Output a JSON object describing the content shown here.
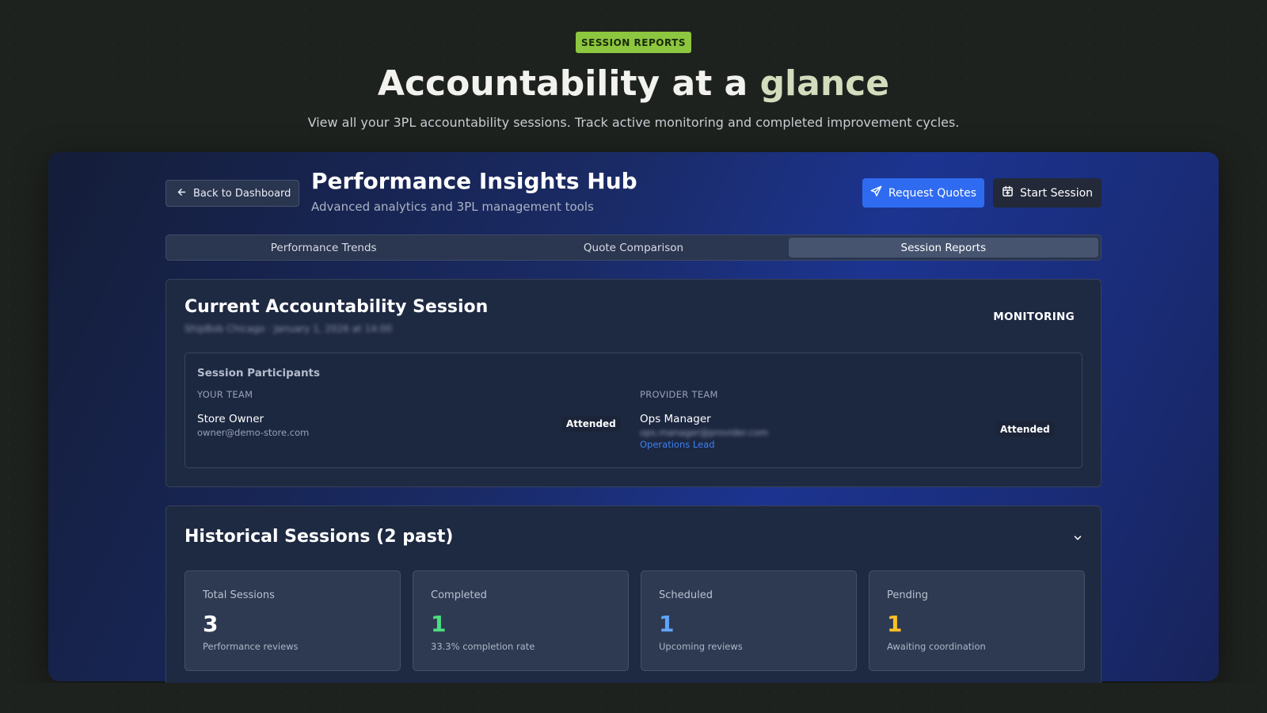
{
  "hero": {
    "badge": "SESSION REPORTS",
    "title_main": "Accountability at a ",
    "title_accent": "glance",
    "subtitle": "View all your 3PL accountability sessions. Track active monitoring and completed improvement cycles."
  },
  "header": {
    "back_label": "Back to Dashboard",
    "title": "Performance Insights Hub",
    "subtitle": "Advanced analytics and 3PL management tools",
    "request_quotes_label": "Request Quotes",
    "start_session_label": "Start Session"
  },
  "tabs": [
    {
      "label": "Performance Trends",
      "active": false
    },
    {
      "label": "Quote Comparison",
      "active": false
    },
    {
      "label": "Session Reports",
      "active": true
    }
  ],
  "current_session": {
    "title": "Current Accountability Session",
    "meta": "ShipBob Chicago · January 1, 2026 at 14:00",
    "status": "MONITORING",
    "participants_title": "Session Participants",
    "your_team": {
      "label": "YOUR TEAM",
      "name": "Store Owner",
      "email": "owner@demo-store.com",
      "status": "Attended"
    },
    "provider_team": {
      "label": "PROVIDER TEAM",
      "name": "Ops Manager",
      "email": "ops.manager@provider.com",
      "role": "Operations Lead",
      "status": "Attended"
    }
  },
  "historical": {
    "title": "Historical Sessions (2 past)",
    "stats": [
      {
        "label": "Total Sessions",
        "value": "3",
        "note": "Performance reviews",
        "color": "#ffffff"
      },
      {
        "label": "Completed",
        "value": "1",
        "note": "33.3% completion rate",
        "color": "#4ade80"
      },
      {
        "label": "Scheduled",
        "value": "1",
        "note": "Upcoming reviews",
        "color": "#60a5fa"
      },
      {
        "label": "Pending",
        "value": "1",
        "note": "Awaiting coordination",
        "color": "#fbbf24"
      }
    ]
  },
  "icons": {
    "back": "arrow-left-icon",
    "quotes": "send-icon",
    "session": "calendar-icon",
    "collapse": "chevron-down-icon"
  },
  "colors": {
    "badge": "#8dc63f",
    "primary": "#2f6bf0",
    "link": "#3d82f5"
  }
}
